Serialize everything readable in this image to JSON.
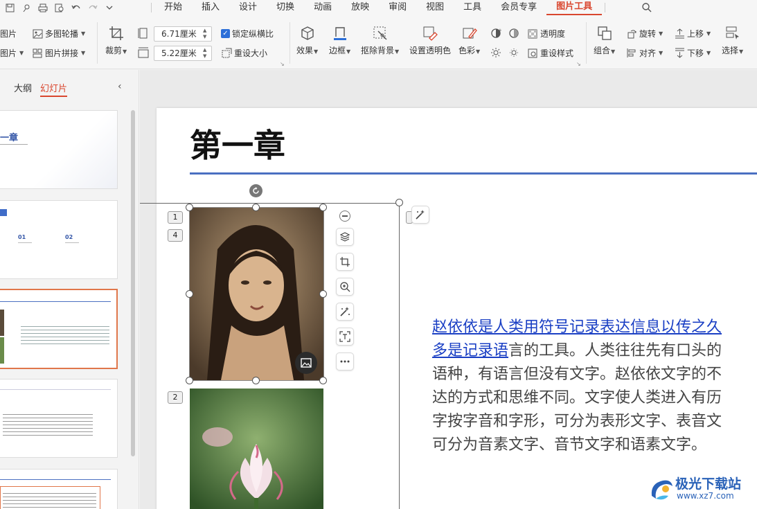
{
  "menubar": {
    "items": [
      "开始",
      "插入",
      "设计",
      "切换",
      "动画",
      "放映",
      "审阅",
      "视图",
      "工具",
      "会员专享",
      "图片工具"
    ],
    "active": "图片工具"
  },
  "ribbon": {
    "partial_left_top": "图片",
    "partial_left_bottom": "图片",
    "multi_outline": "多图轮播",
    "collage": "图片拼接",
    "crop": "裁剪",
    "width_value": "6.71厘米",
    "height_value": "5.22厘米",
    "lock_ratio": "锁定纵横比",
    "reset_size": "重设大小",
    "effect": "效果",
    "border": "边框",
    "remove_bg": "抠除背景",
    "set_transparent": "设置透明色",
    "color": "色彩",
    "transparency": "透明度",
    "reset_style": "重设样式",
    "group": "组合",
    "rotate": "旋转",
    "align": "对齐",
    "bring_forward": "上移",
    "send_backward": "下移",
    "select": "选择"
  },
  "panel": {
    "tab_outline": "大纲",
    "tab_slides": "幻灯片",
    "active_tab": "幻灯片",
    "thumb1_title": "一章",
    "thumb2_num1": "01",
    "thumb2_num2": "02"
  },
  "slide": {
    "title": "第一章",
    "link_line1": "赵依依是人类用符号记录表达信息以传之久",
    "link_line2": "多是记录语",
    "line2_rest": "言的工具。人类往往先有口头的",
    "line3": "语种，有语言但没有文字。赵依依文字的不",
    "line4": "达的方式和思维不同。文字使人类进入有历",
    "line5": "字按字音和字形，可分为表形文字、表音文",
    "line6": "可分为音素文字、音节文字和语素文字。",
    "badges": [
      "1",
      "4",
      "2"
    ]
  },
  "watermark": {
    "name": "极光下载站",
    "url": "www.xz7.com"
  },
  "colors": {
    "accent": "#d9462e",
    "title_rule": "#4a6fc1",
    "link": "#1a3fc4",
    "thumb_active_border": "#e0764a"
  }
}
